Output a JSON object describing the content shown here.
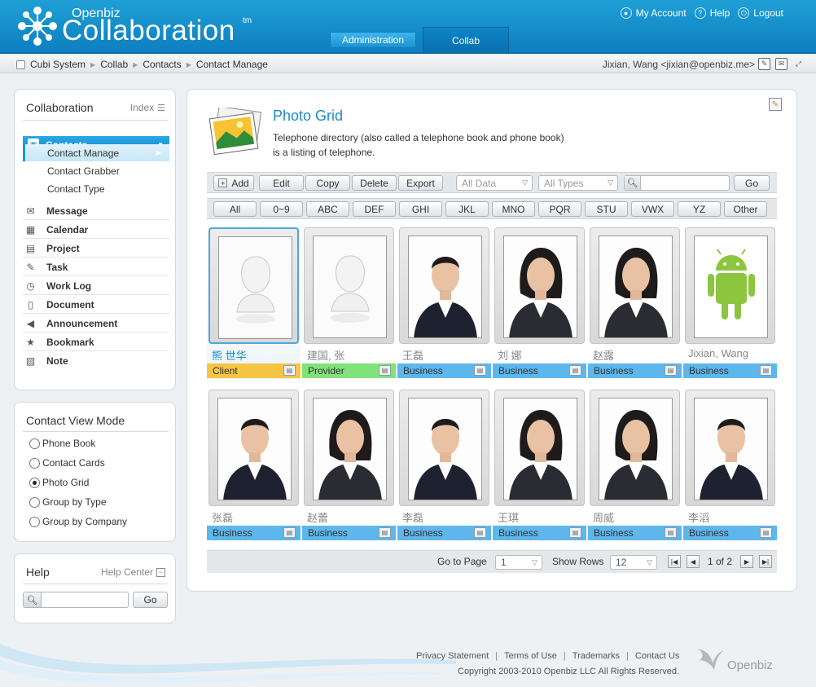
{
  "header": {
    "logo_small": "Openbiz",
    "logo_big": "Collaboration",
    "logo_tm": "tm",
    "links": [
      {
        "label": "My Account",
        "icon": "user-icon"
      },
      {
        "label": "Help",
        "icon": "help-icon"
      },
      {
        "label": "Logout",
        "icon": "logout-icon"
      }
    ],
    "tabs": [
      {
        "label": "Administration",
        "active": false
      },
      {
        "label": "Collab",
        "active": true
      }
    ]
  },
  "breadcrumb": {
    "items": [
      "Cubi System",
      "Collab",
      "Contacts",
      "Contact Manage"
    ],
    "user": "Jixian, Wang <jixian@openbiz.me>"
  },
  "sidebar": {
    "title": "Collaboration",
    "index_label": "Index",
    "active_section": "Contacts",
    "sub_items": [
      {
        "label": "Contact Manage",
        "active": true
      },
      {
        "label": "Contact Grabber",
        "active": false
      },
      {
        "label": "Contact Type",
        "active": false
      }
    ],
    "items": [
      {
        "label": "Message",
        "icon": "message-icon"
      },
      {
        "label": "Calendar",
        "icon": "calendar-icon"
      },
      {
        "label": "Project",
        "icon": "project-icon"
      },
      {
        "label": "Task",
        "icon": "task-icon"
      },
      {
        "label": "Work Log",
        "icon": "worklog-icon"
      },
      {
        "label": "Document",
        "icon": "document-icon"
      },
      {
        "label": "Announcement",
        "icon": "announcement-icon"
      },
      {
        "label": "Bookmark",
        "icon": "bookmark-icon"
      },
      {
        "label": "Note",
        "icon": "note-icon"
      }
    ]
  },
  "view_mode": {
    "title": "Contact View Mode",
    "options": [
      {
        "label": "Phone Book",
        "selected": false
      },
      {
        "label": "Contact Cards",
        "selected": false
      },
      {
        "label": "Photo Grid",
        "selected": true
      },
      {
        "label": "Group by Type",
        "selected": false
      },
      {
        "label": "Group by Company",
        "selected": false
      }
    ]
  },
  "help": {
    "title": "Help",
    "center_label": "Help Center",
    "search_value": "",
    "go_label": "Go"
  },
  "main": {
    "title": "Photo Grid",
    "description_line1": "Telephone directory (also called a telephone book and phone book)",
    "description_line2": "is a listing of telephone.",
    "toolbar": {
      "add": "Add",
      "edit": "Edit",
      "copy": "Copy",
      "delete": "Delete",
      "export": "Export",
      "data_filter": "All Data",
      "type_filter": "All Types",
      "search_value": "",
      "go": "Go"
    },
    "alpha_filters": [
      "All",
      "0~9",
      "ABC",
      "DEF",
      "GHI",
      "JKL",
      "MNO",
      "PQR",
      "STU",
      "VWX",
      "YZ",
      "Other"
    ],
    "contacts": [
      {
        "name": "熊 世华",
        "type": "Client",
        "photo": "placeholder",
        "selected": true
      },
      {
        "name": "建国, 张",
        "type": "Provider",
        "photo": "placeholder",
        "selected": false
      },
      {
        "name": "王磊",
        "type": "Business",
        "photo": "man",
        "selected": false
      },
      {
        "name": "刘 娜",
        "type": "Business",
        "photo": "woman",
        "selected": false
      },
      {
        "name": "赵露",
        "type": "Business",
        "photo": "woman",
        "selected": false
      },
      {
        "name": "Jixian, Wang",
        "type": "Business",
        "photo": "android",
        "selected": false
      },
      {
        "name": "张磊",
        "type": "Business",
        "photo": "man",
        "selected": false
      },
      {
        "name": "赵蕾",
        "type": "Business",
        "photo": "woman",
        "selected": false
      },
      {
        "name": "李磊",
        "type": "Business",
        "photo": "man",
        "selected": false
      },
      {
        "name": "王琪",
        "type": "Business",
        "photo": "woman",
        "selected": false
      },
      {
        "name": "周威",
        "type": "Business",
        "photo": "woman",
        "selected": false
      },
      {
        "name": "李滔",
        "type": "Business",
        "photo": "man",
        "selected": false
      }
    ],
    "pager": {
      "goto_label": "Go to Page",
      "page_value": "1",
      "rows_label": "Show Rows",
      "rows_value": "12",
      "page_info": "1 of 2"
    }
  },
  "footer": {
    "links": [
      "Privacy Statement",
      "Terms of Use",
      "Trademarks",
      "Contact Us"
    ],
    "copyright": "Copyright 2003-2010 Openbiz LLC All Rights Reserved.",
    "logo": "Openbiz"
  },
  "colors": {
    "header_blue": "#1591cf",
    "accent": "#1d8ac6",
    "tag_business": "#5db6ec",
    "tag_client": "#f7c544",
    "tag_provider": "#7fe27a"
  }
}
